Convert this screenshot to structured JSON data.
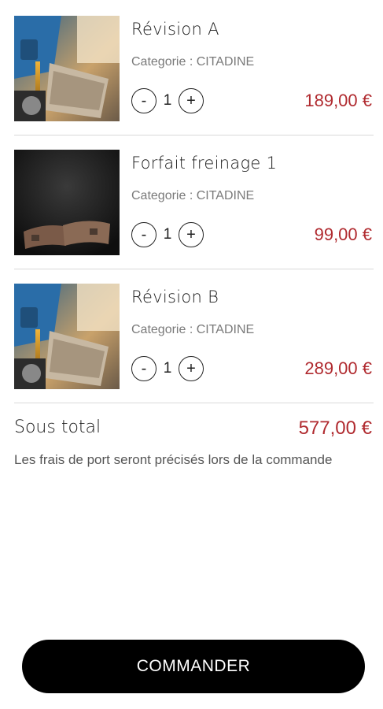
{
  "cart": {
    "items": [
      {
        "title": "Révision A",
        "category": "Categorie : CITADINE",
        "quantity": "1",
        "price": "189,00 €",
        "minus": "-",
        "plus": "+"
      },
      {
        "title": "Forfait freinage 1",
        "category": "Categorie : CITADINE",
        "quantity": "1",
        "price": "99,00 €",
        "minus": "-",
        "plus": "+"
      },
      {
        "title": "Révision B",
        "category": "Categorie : CITADINE",
        "quantity": "1",
        "price": "289,00 €",
        "minus": "-",
        "plus": "+"
      }
    ]
  },
  "summary": {
    "subtotal_label": "Sous total",
    "subtotal_value": "577,00 €",
    "shipping_note": "Les frais de port seront précisés lors de la commande"
  },
  "actions": {
    "order_label": "COMMANDER"
  },
  "colors": {
    "price": "#b02a2f",
    "button": "#000000",
    "divider": "#d9d9d9"
  },
  "icons": [
    "oil-change-photo",
    "brake-pads-photo",
    "minus-icon",
    "plus-icon"
  ]
}
